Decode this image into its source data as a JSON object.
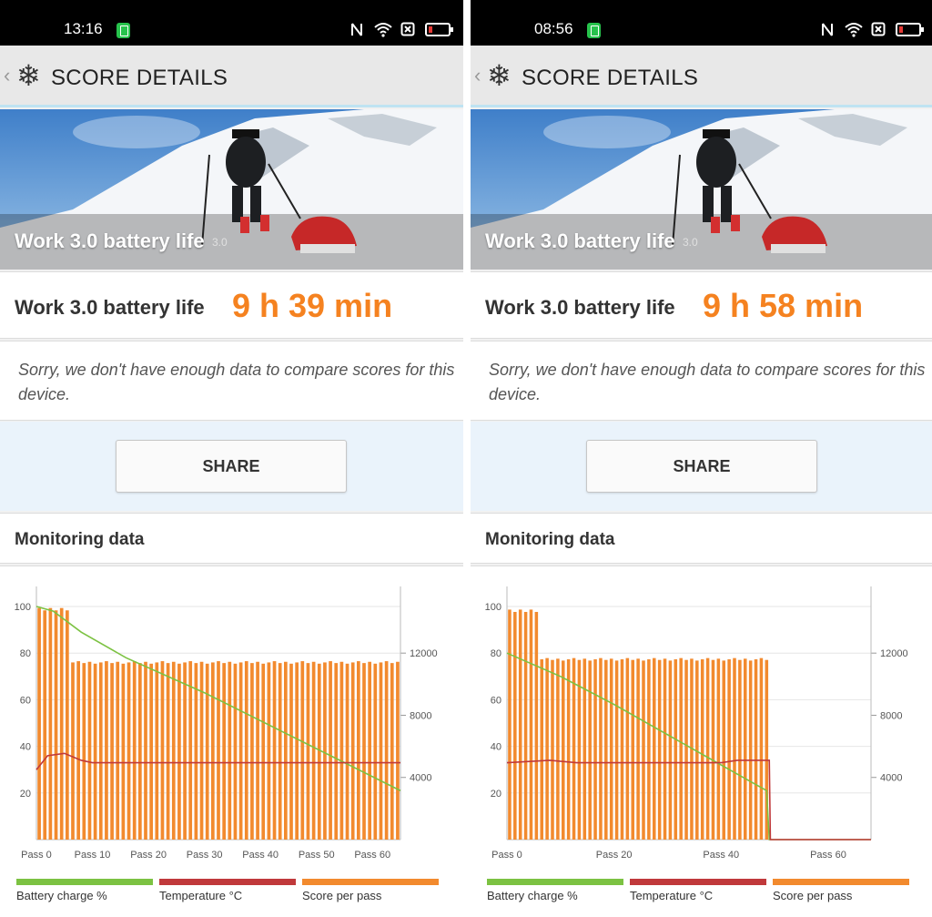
{
  "panels": [
    {
      "status": {
        "time": "13:16"
      },
      "header": {
        "title": "SCORE DETAILS",
        "back": "‹",
        "logo": "❄"
      },
      "banner": {
        "title": "Work 3.0 battery life",
        "version": "3.0"
      },
      "score": {
        "label": "Work 3.0 battery life",
        "value": "9 h 39 min"
      },
      "message": "Sorry, we don't have enough data to compare scores for this device.",
      "share_label": "SHARE",
      "monitoring_title": "Monitoring data",
      "legend": [
        "Battery charge %",
        "Temperature °C",
        "Score per pass"
      ],
      "chart_data": {
        "type": "bar",
        "x_tick_labels": [
          "Pass 0",
          "Pass 10",
          "Pass 20",
          "Pass 30",
          "Pass 40",
          "Pass 50",
          "Pass 60"
        ],
        "x_tick_passes": [
          0,
          10,
          20,
          30,
          40,
          50,
          60
        ],
        "y_left_ticks": [
          20,
          40,
          60,
          80,
          100
        ],
        "y_left_range": [
          0,
          100
        ],
        "y_right_ticks": [
          4000,
          8000,
          12000
        ],
        "y_right_range": [
          0,
          15000
        ],
        "pass_count": 65,
        "series": [
          {
            "name": "Score per pass",
            "axis": "right",
            "high_passes": 6,
            "high_value": 14900,
            "typical_value": 11400
          },
          {
            "name": "Battery charge %",
            "axis": "left",
            "x": [
              0,
              3,
              8,
              16,
              30,
              45,
              55,
              65
            ],
            "values": [
              100,
              98,
              89,
              78,
              63,
              45,
              33,
              21
            ]
          },
          {
            "name": "Temperature °C",
            "axis": "left",
            "x": [
              0,
              2,
              5,
              8,
              10,
              65
            ],
            "values": [
              30,
              36,
              37,
              34,
              33,
              33
            ]
          }
        ],
        "colors": {
          "score": "#f28a2e",
          "battery": "#7cc242",
          "temperature": "#c0393b"
        }
      }
    },
    {
      "status": {
        "time": "08:56"
      },
      "header": {
        "title": "SCORE DETAILS",
        "back": "‹",
        "logo": "❄"
      },
      "banner": {
        "title": "Work 3.0 battery life",
        "version": "3.0"
      },
      "score": {
        "label": "Work 3.0 battery life",
        "value": "9 h 58 min"
      },
      "message": "Sorry, we don't have enough data to compare scores for this device.",
      "share_label": "SHARE",
      "monitoring_title": "Monitoring data",
      "legend": [
        "Battery charge %",
        "Temperature °C",
        "Score per pass"
      ],
      "chart_data": {
        "type": "bar",
        "x_tick_labels": [
          "Pass 0",
          "Pass 20",
          "Pass 40",
          "Pass 60"
        ],
        "x_tick_passes": [
          0,
          20,
          40,
          60
        ],
        "y_left_ticks": [
          20,
          40,
          60,
          80,
          100
        ],
        "y_left_range": [
          0,
          100
        ],
        "y_right_ticks": [
          4000,
          8000,
          12000
        ],
        "y_right_range": [
          0,
          15000
        ],
        "pass_count": 68,
        "series": [
          {
            "name": "Score per pass",
            "axis": "right",
            "high_passes": 6,
            "high_value": 14800,
            "typical_value": 11600
          },
          {
            "name": "Battery charge %",
            "axis": "left",
            "x": [
              0,
              10,
              20,
              30,
              40,
              48.5,
              49,
              68
            ],
            "values": [
              80,
              70,
              58,
              45,
              32,
              21,
              0,
              0
            ]
          },
          {
            "name": "Temperature °C",
            "axis": "left",
            "x": [
              0,
              8,
              13,
              40,
              43,
              49,
              49.2,
              68
            ],
            "values": [
              33,
              34,
              33,
              33,
              34,
              34,
              0,
              0
            ]
          }
        ],
        "colors": {
          "score": "#f28a2e",
          "battery": "#7cc242",
          "temperature": "#c0393b"
        }
      }
    }
  ]
}
